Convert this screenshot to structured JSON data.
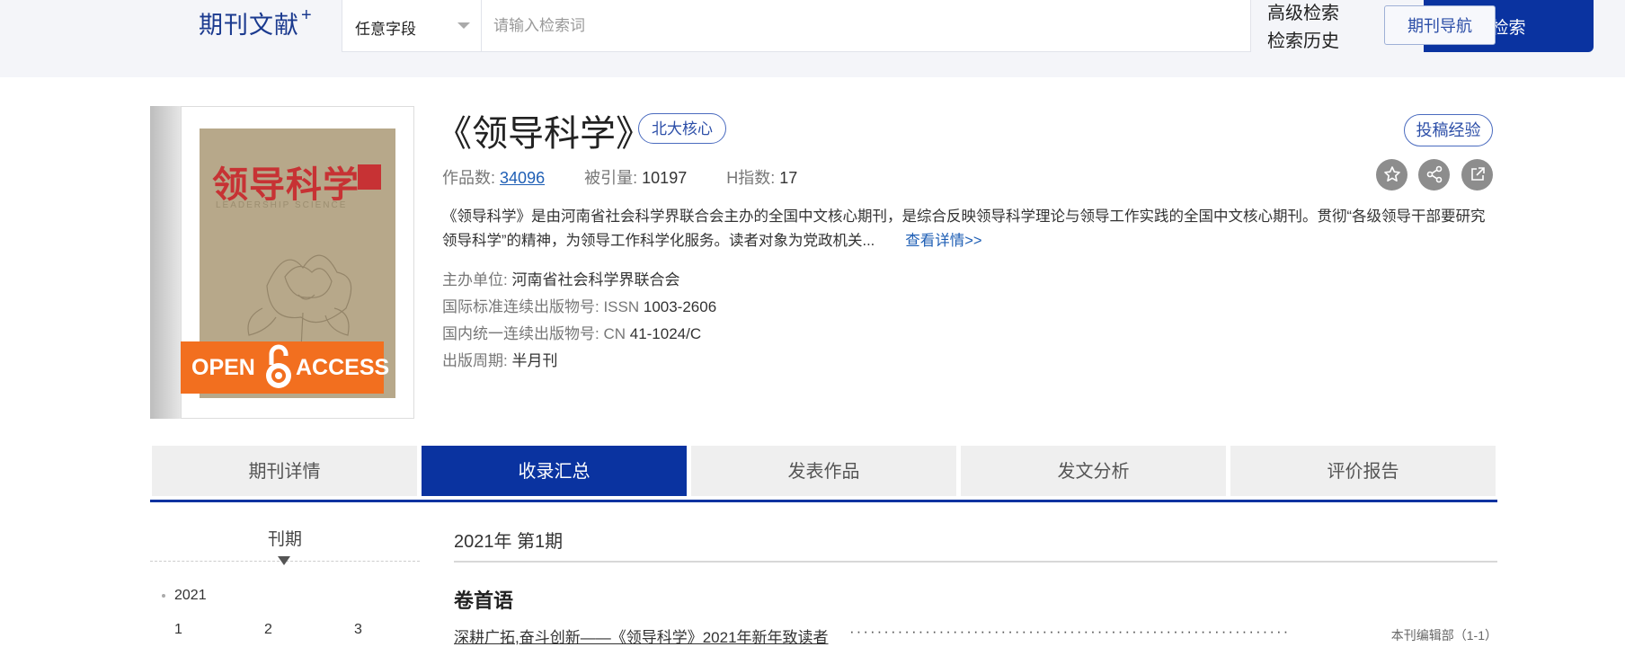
{
  "header": {
    "brand": "期刊文献",
    "brand_plus": "+",
    "field_select": "任意字段",
    "search_placeholder": "请输入检索词",
    "search_button": "检索",
    "advanced_search": "高级检索",
    "search_history": "检索历史",
    "journal_nav": "期刊导航"
  },
  "journal": {
    "title": "《领导科学》",
    "core_badge": "北大核心",
    "submit_exp": "投稿经验",
    "cover_title": "领导科学",
    "cover_subtitle": "LEADERSHIP SCIENCE",
    "open_access_left": "OPEN",
    "open_access_right": "ACCESS",
    "stats": {
      "works_label": "作品数:",
      "works_value": "34096",
      "cited_label": "被引量:",
      "cited_value": "10197",
      "h_label": "H指数:",
      "h_value": "17"
    },
    "action_icons": [
      "star-icon",
      "share-icon",
      "external-link-icon"
    ],
    "description": "《领导科学》是由河南省社会科学界联合会主办的全国中文核心期刊，是综合反映领导科学理论与领导工作实践的全国中文核心期刊。贯彻“各级领导干部要研究领导科学”的精神，为领导工作科学化服务。读者对象为党政机关...",
    "more_link": "查看详情>>",
    "meta": [
      {
        "label": "主办单位:",
        "value": "河南省社会科学界联合会"
      },
      {
        "label": "国际标准连续出版物号: ISSN",
        "value": "1003-2606"
      },
      {
        "label": "国内统一连续出版物号: CN",
        "value": "41-1024/C"
      },
      {
        "label": "出版周期:",
        "value": "半月刊"
      }
    ]
  },
  "tabs": [
    {
      "label": "期刊详情",
      "active": false
    },
    {
      "label": "收录汇总",
      "active": true
    },
    {
      "label": "发表作品",
      "active": false
    },
    {
      "label": "发文分析",
      "active": false
    },
    {
      "label": "评价报告",
      "active": false
    }
  ],
  "issues": {
    "heading": "刊期",
    "year": "2021",
    "numbers": [
      "1",
      "2",
      "3"
    ]
  },
  "content": {
    "current_issue": "2021年 第1期",
    "section": "卷首语",
    "article_title": "深耕广拓,奋斗创新——《领导科学》2021年新年致读者",
    "article_author": "本刊编辑部（1-1）"
  },
  "colors": {
    "primary": "#0a33a0",
    "link": "#1f5fb5",
    "open_access": "#f26f1f"
  }
}
